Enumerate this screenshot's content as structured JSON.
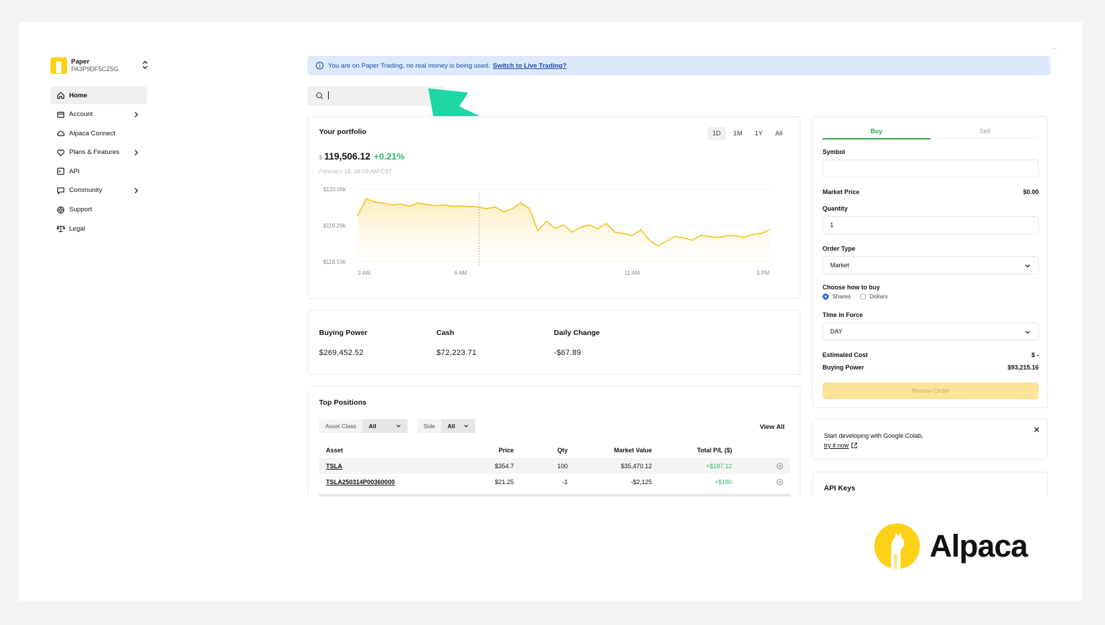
{
  "account": {
    "name": "Paper",
    "id": "PA3P9DF5CZ5G"
  },
  "sidebar": {
    "items": [
      {
        "label": "Home",
        "icon": "home-icon",
        "active": true,
        "chevron": false
      },
      {
        "label": "Account",
        "icon": "wallet-icon",
        "active": false,
        "chevron": true
      },
      {
        "label": "Alpaca Connect",
        "icon": "cloud-icon",
        "active": false,
        "chevron": false
      },
      {
        "label": "Plans & Features",
        "icon": "heart-icon",
        "active": false,
        "chevron": true
      },
      {
        "label": "API",
        "icon": "terminal-icon",
        "active": false,
        "chevron": false
      },
      {
        "label": "Community",
        "icon": "chat-icon",
        "active": false,
        "chevron": true
      },
      {
        "label": "Support",
        "icon": "lifebuoy-icon",
        "active": false,
        "chevron": false
      },
      {
        "label": "Legal",
        "icon": "scale-icon",
        "active": false,
        "chevron": false
      }
    ]
  },
  "banner": {
    "text": "You are on Paper Trading, no real money is being used.",
    "link": "Switch to Live Trading?"
  },
  "search": {
    "value": "",
    "placeholder": ""
  },
  "portfolio": {
    "title": "Your portfolio",
    "currency": "$",
    "value": "119,506.12",
    "change": "+0.21%",
    "date": "February 18, 06:59 AM CST",
    "ranges": [
      "1D",
      "1M",
      "1Y",
      "All"
    ],
    "active_range": "1D"
  },
  "chart_data": {
    "type": "area",
    "title": "",
    "y_tick_labels": [
      "$120.05k",
      "$119.29k",
      "$118.53k"
    ],
    "x_tick_labels": [
      "3 AM",
      "6 AM",
      "11 AM",
      "3 PM"
    ],
    "ylim": [
      118530,
      120050
    ],
    "line_color": "#f2c21b",
    "x": [
      "03:00",
      "03:15",
      "03:30",
      "03:45",
      "04:00",
      "04:15",
      "04:30",
      "04:45",
      "05:00",
      "05:15",
      "05:30",
      "05:45",
      "06:00",
      "06:15",
      "06:30",
      "06:45",
      "07:00",
      "07:15",
      "07:30",
      "07:45",
      "08:00",
      "08:15",
      "08:30",
      "08:45",
      "09:00",
      "09:15",
      "09:30",
      "09:45",
      "10:00",
      "10:15",
      "10:30",
      "10:45",
      "11:00",
      "11:15",
      "11:30",
      "11:45",
      "12:00",
      "12:15",
      "12:30",
      "12:45",
      "13:00",
      "13:15",
      "13:30",
      "13:45",
      "14:00",
      "14:15",
      "14:30",
      "14:45",
      "15:00"
    ],
    "values": [
      119500,
      119850,
      119780,
      119760,
      119720,
      119740,
      119690,
      119760,
      119730,
      119700,
      119720,
      119690,
      119700,
      119690,
      119680,
      119640,
      119680,
      119580,
      119640,
      119760,
      119650,
      119180,
      119380,
      119230,
      119300,
      119150,
      119250,
      119300,
      119220,
      119330,
      119150,
      119120,
      119080,
      119200,
      118980,
      118860,
      118960,
      119060,
      119030,
      118980,
      119080,
      119060,
      119040,
      119070,
      119080,
      119040,
      119100,
      119120,
      119200
    ],
    "grid": true
  },
  "balances": [
    {
      "label": "Buying Power",
      "value": "$269,452.52"
    },
    {
      "label": "Cash",
      "value": "$72,223.71"
    },
    {
      "label": "Daily Change",
      "value": "-$67.89"
    }
  ],
  "positions": {
    "title": "Top Positions",
    "filters": [
      {
        "label": "Asset Class",
        "value": "All"
      },
      {
        "label": "Side",
        "value": "All"
      }
    ],
    "view_all": "View All",
    "columns": [
      "Asset",
      "Price",
      "Qty",
      "Market Value",
      "Total P/L ($)"
    ],
    "rows": [
      [
        "TSLA",
        "$354.7",
        "100",
        "$35,470.12",
        "+$187.12"
      ],
      [
        "TSLA250314P00360000",
        "$21.25",
        "-1",
        "-$2,125",
        "+$180"
      ]
    ]
  },
  "order": {
    "tabs": [
      "Buy",
      "Sell"
    ],
    "symbol_label": "Symbol",
    "symbol_value": "",
    "market_price_label": "Market Price",
    "market_price_value": "$0.00",
    "quantity_label": "Quantity",
    "quantity_value": "1",
    "order_type_label": "Order Type",
    "order_type_value": "Market",
    "how_label": "Choose how to buy",
    "how_options": [
      "Shares",
      "Dollars"
    ],
    "how_selected": "Shares",
    "tif_label": "Time in Force",
    "tif_value": "DAY",
    "est_cost_label": "Estimated Cost",
    "est_cost_value": "$ -",
    "bp_label": "Buying Power",
    "bp_value": "$93,215.16",
    "review_label": "Review Order"
  },
  "colab": {
    "text": "Start developing with Google Colab,",
    "link": "try it now"
  },
  "api_keys": {
    "title": "API Keys"
  },
  "brand": {
    "name": "Alpaca"
  },
  "colors": {
    "accent_green": "#2fb86e",
    "brand_yellow": "#fcd116",
    "arrow": "#1fd6a4",
    "banner_bg": "#dce9fb"
  }
}
